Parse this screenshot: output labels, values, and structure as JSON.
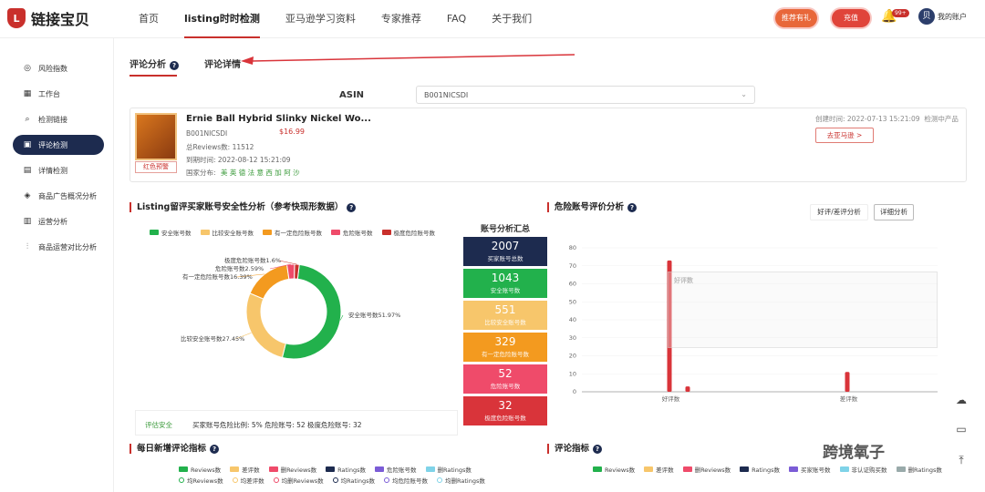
{
  "brand": "链接宝贝",
  "nav": [
    "首页",
    "listing时时检测",
    "亚马逊学习资料",
    "专家推荐",
    "FAQ",
    "关于我们"
  ],
  "top_buttons": {
    "gift": "推荐有礼",
    "recharge": "充值",
    "badge": "99+",
    "avatar": "贝",
    "account": "我的账户"
  },
  "sidebar": [
    "风险指数",
    "工作台",
    "检测链接",
    "评论检测",
    "详情检测",
    "商品广告概况分析",
    "运营分析",
    "商品运营对比分析"
  ],
  "tabs": {
    "analysis": "评论分析",
    "detail": "评论详情"
  },
  "asin": {
    "label": "ASIN",
    "value": "B001NICSDI"
  },
  "product": {
    "title": "Ernie Ball Hybrid Slinky Nickel Wo...",
    "asin": "B001NICSDI",
    "price": "$16.99",
    "reviews": "总Reviews数: 11512",
    "time": "到期时间: 2022-08-12 15:21:09",
    "countries_label": "国家分布:",
    "countries": "美 英 德 法 意 西 加 阿 沙",
    "tag": "红色预警",
    "created": "创建时间: 2022-07-13 15:21:09",
    "status": "检测中产品",
    "link_btn": "去亚马逊 >"
  },
  "left_section": {
    "title": "Listing留评买家账号安全性分析（参考快现形数据）",
    "summary_title": "账号分析汇总"
  },
  "legend": [
    {
      "label": "安全账号数",
      "color": "#22b14c"
    },
    {
      "label": "比较安全账号数",
      "color": "#f7c66b"
    },
    {
      "label": "有一定危险账号数",
      "color": "#f39a1f"
    },
    {
      "label": "危险账号数",
      "color": "#ef4b6a"
    },
    {
      "label": "极度危险账号数",
      "color": "#c9302c"
    }
  ],
  "chart_data": [
    {
      "type": "pie",
      "slices": [
        {
          "label": "安全账号数",
          "value": 51.97
        },
        {
          "label": "比较安全账号数",
          "value": 27.45
        },
        {
          "label": "有一定危险账号数",
          "value": 16.39
        },
        {
          "label": "危险账号数",
          "value": 2.59
        },
        {
          "label": "极度危险账号数",
          "value": 1.6
        }
      ],
      "labels": [
        "安全账号数51.97%",
        "比较安全账号数27.45%",
        "有一定危险账号数16.39%",
        "危险账号数2.59%",
        "极度危险账号数1.6%"
      ]
    },
    {
      "type": "bar",
      "title": "危险账号评价分析",
      "categories": [
        "好评数",
        "差评数"
      ],
      "yticks": [
        0,
        10,
        20,
        30,
        40,
        50,
        60,
        70,
        80
      ],
      "ylim": [
        0,
        80
      ],
      "series": [
        {
          "color": "#d9343a",
          "values": [
            73,
            11
          ]
        },
        {
          "color": "#d9343a",
          "values": [
            3,
            0
          ]
        }
      ]
    }
  ],
  "summary": [
    {
      "n": "2007",
      "l": "买家账号总数",
      "c": "#1d2b4f"
    },
    {
      "n": "1043",
      "l": "安全账号数",
      "c": "#22b14c"
    },
    {
      "n": "551",
      "l": "比较安全账号数",
      "c": "#f7c66b"
    },
    {
      "n": "329",
      "l": "有一定危险账号数",
      "c": "#f39a1f"
    },
    {
      "n": "52",
      "l": "危险账号数",
      "c": "#ef4b6a"
    },
    {
      "n": "32",
      "l": "极度危险账号数",
      "c": "#d9343a"
    }
  ],
  "note": {
    "tag": "评估安全",
    "text": "买家账号危险比例: 5%  危险账号: 52  极度危险账号: 32"
  },
  "right_section": {
    "title": "危险账号评价分析",
    "btn1": "好评/差评分析",
    "btn2": "详细分析"
  },
  "tooltip": {
    "title": "好评数"
  },
  "bottom": {
    "left_title": "每日新增评论指标",
    "right_title": "评论指标",
    "left_legend1": [
      "Reviews数",
      "差评数",
      "删Reviews数",
      "Ratings数",
      "危险账号数",
      "删Ratings数"
    ],
    "left_legend2": [
      "均Reviews数",
      "均差评数",
      "均删Reviews数",
      "均Ratings数",
      "均危险账号数",
      "均删Ratings数"
    ],
    "right_legend": [
      "Reviews数",
      "差评数",
      "删Reviews数",
      "Ratings数",
      "买家账号数",
      "非认证购买数",
      "删Ratings数"
    ]
  },
  "watermark": "跨境氧子"
}
